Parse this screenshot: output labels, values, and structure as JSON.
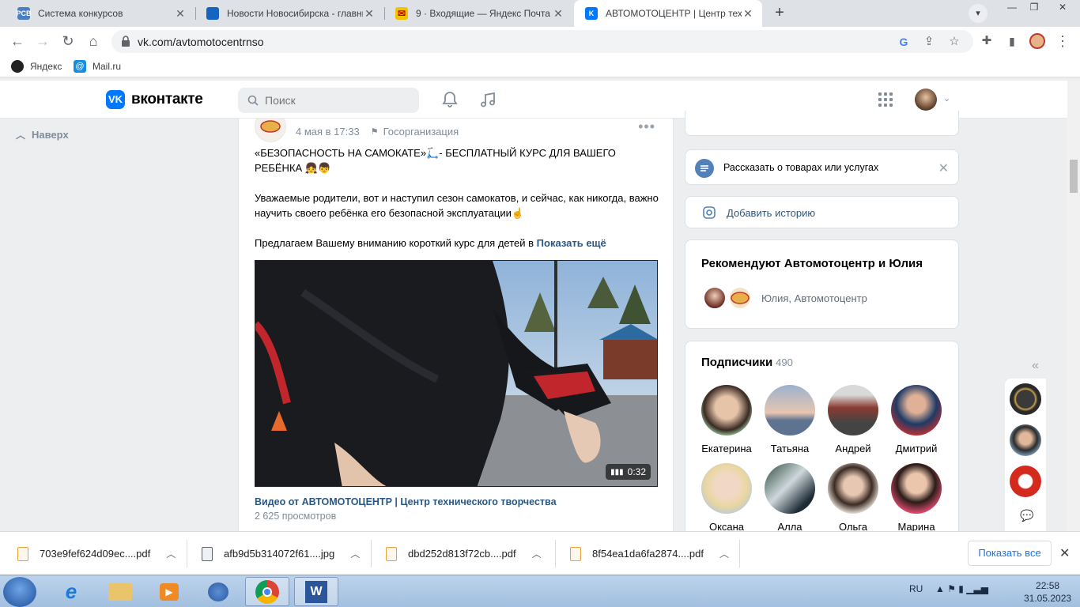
{
  "browser": {
    "tabs": [
      {
        "title": "Система конкурсов",
        "active": false
      },
      {
        "title": "Новости Новосибирска - главные",
        "active": false
      },
      {
        "title": "9 · Входящие — Яндекс Почта",
        "active": false
      },
      {
        "title": "АВТОМОТОЦЕНТР | Центр техни",
        "active": true
      }
    ],
    "url": "vk.com/avtomotocentrnso",
    "bookmarks": [
      "Яндекс",
      "Mail.ru"
    ]
  },
  "vk": {
    "logo_text": "вконтакте",
    "logo_letter": "VK",
    "search_placeholder": "Поиск",
    "up_label": "Наверх"
  },
  "post": {
    "date": "4 мая в 17:33",
    "category": "Госорганизация",
    "text_line1": "«БЕЗОПАСНОСТЬ НА САМОКАТЕ»🛴- БЕСПЛАТНЫЙ КУРС ДЛЯ ВАШЕГО РЕБЁНКА 👧👦",
    "text_line2": "Уважаемые родители, вот и наступил сезон самокатов, и сейчас, как никогда, важно научить своего ребёнка его безопасной эксплуатации☝",
    "text_line3": "Предлагаем Вашему вниманию короткий курс для детей в",
    "show_more": "Показать ещё",
    "video": {
      "duration": "0:32",
      "title": "Видео от АВТОМОТОЦЕНТР | Центр технического творчества",
      "views": "2 625 просмотров"
    }
  },
  "sidebar": {
    "tell_label": "Рассказать о товарах или услугах",
    "story_label": "Добавить историю",
    "recommend_title": "Рекомендуют Автомотоцентр и Юлия",
    "recommend_names": "Юлия, Автомотоцентр",
    "subscribers_title": "Подписчики",
    "subscribers_count": "490",
    "subscribers": [
      {
        "name": "Екатерина"
      },
      {
        "name": "Татьяна"
      },
      {
        "name": "Андрей"
      },
      {
        "name": "Дмитрий"
      },
      {
        "name": "Оксана"
      },
      {
        "name": "Алла"
      },
      {
        "name": "Ольга"
      },
      {
        "name": "Марина"
      }
    ]
  },
  "downloads": {
    "items": [
      {
        "name": "703e9fef624d09ec....pdf",
        "kind": "pdf"
      },
      {
        "name": "afb9d5b314072f61....jpg",
        "kind": "jpg"
      },
      {
        "name": "dbd252d813f72cb....pdf",
        "kind": "pdf"
      },
      {
        "name": "8f54ea1da6fa2874....pdf",
        "kind": "pdf"
      }
    ],
    "show_all": "Показать все"
  },
  "taskbar": {
    "lang": "RU",
    "time": "22:58",
    "date": "31.05.2023"
  },
  "colors": {
    "vk_blue": "#0077ff",
    "link": "#2a5885",
    "chrome_accent": "#1a73e8"
  }
}
